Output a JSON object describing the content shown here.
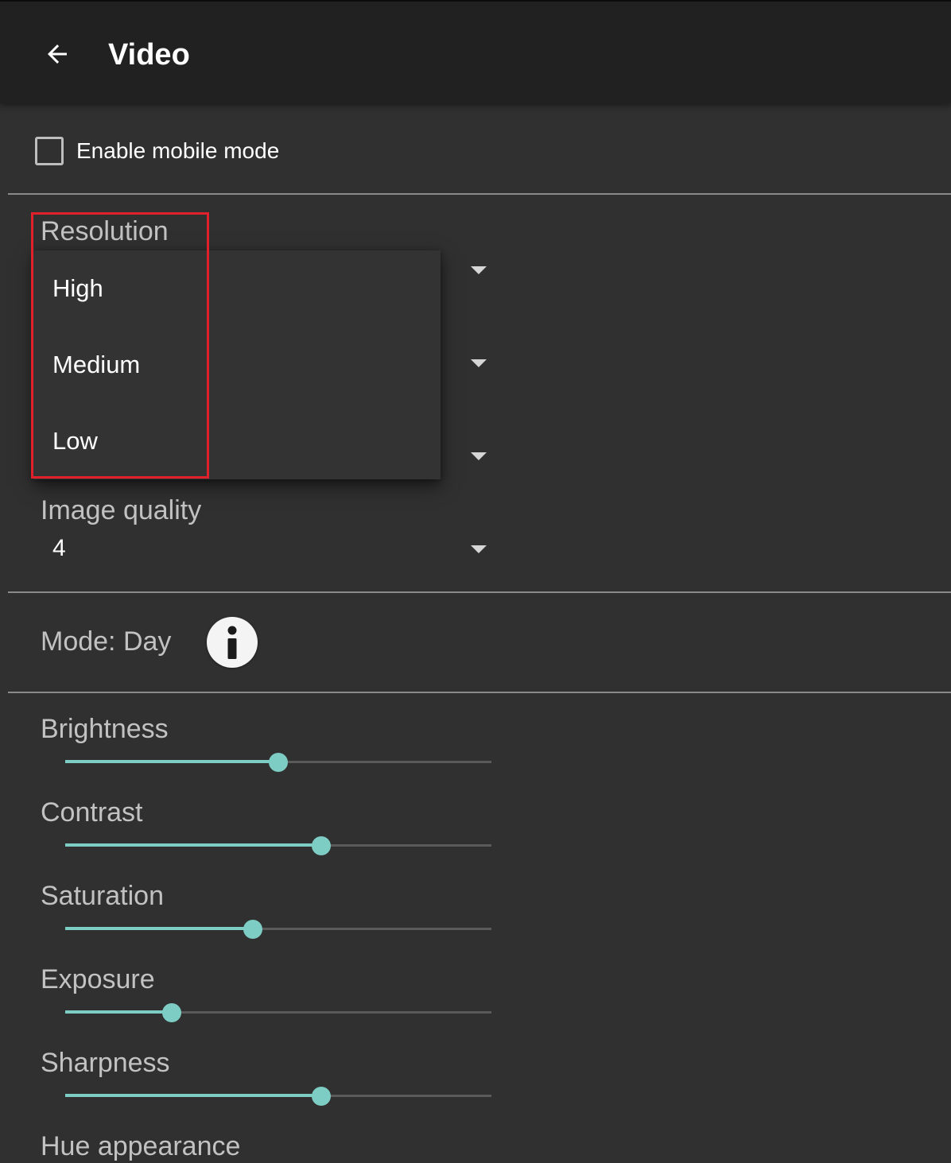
{
  "appbar": {
    "title": "Video",
    "back_icon": "arrow-left-icon"
  },
  "mobile_mode": {
    "label": "Enable mobile mode",
    "checked": false
  },
  "resolution": {
    "label": "Resolution",
    "options": [
      "High",
      "Medium",
      "Low"
    ]
  },
  "image_quality": {
    "label": "Image quality",
    "value": "4"
  },
  "mode": {
    "label": "Mode: Day",
    "info_icon": "info-icon"
  },
  "sliders": [
    {
      "label": "Brightness",
      "value": 0.5
    },
    {
      "label": "Contrast",
      "value": 0.6
    },
    {
      "label": "Saturation",
      "value": 0.44
    },
    {
      "label": "Exposure",
      "value": 0.25
    },
    {
      "label": "Sharpness",
      "value": 0.6
    },
    {
      "label": "Hue appearance"
    }
  ],
  "colors": {
    "accent": "#7ecdc4",
    "background": "#303030",
    "appbar": "#212121",
    "highlight": "#e0202a"
  }
}
